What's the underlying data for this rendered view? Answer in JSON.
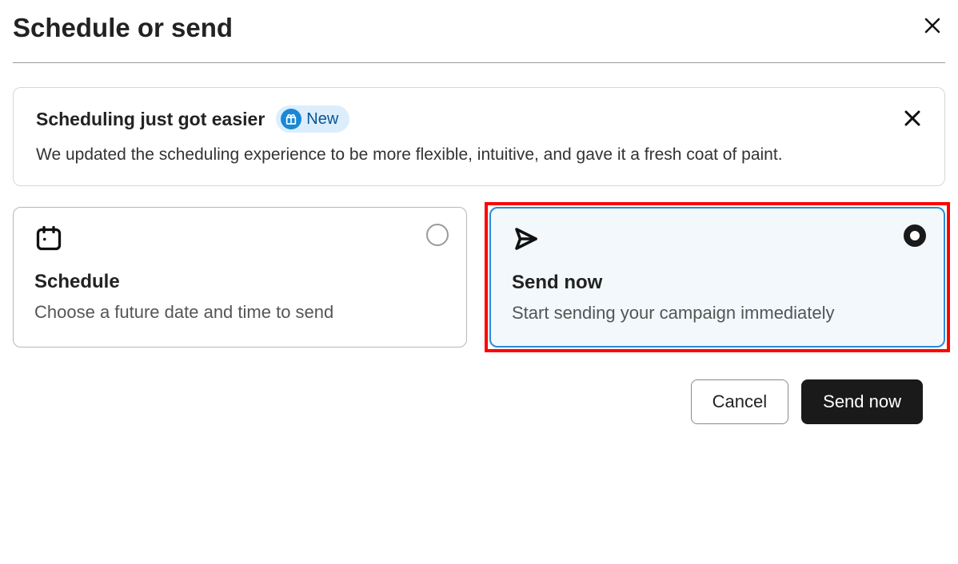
{
  "dialog": {
    "title": "Schedule or send"
  },
  "banner": {
    "title": "Scheduling just got easier",
    "badge_label": "New",
    "body": "We updated the scheduling experience to be more flexible, intuitive, and gave it a fresh coat of paint."
  },
  "options": {
    "schedule": {
      "title": "Schedule",
      "desc": "Choose a future date and time to send",
      "selected": false
    },
    "send_now": {
      "title": "Send now",
      "desc": "Start sending your campaign immediately",
      "selected": true
    }
  },
  "footer": {
    "cancel_label": "Cancel",
    "submit_label": "Send now"
  },
  "colors": {
    "accent_blue": "#2e8ad8",
    "highlight_red": "#ff0000",
    "primary_dark": "#1a1a1a"
  }
}
